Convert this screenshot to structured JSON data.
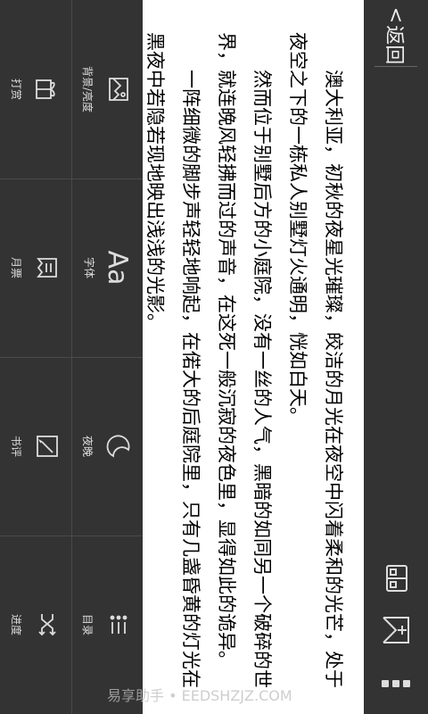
{
  "nav": {
    "back_label": "返回"
  },
  "toolbar_icons": [
    "bookshelf-icon",
    "add-bookmark-icon",
    "more-icon"
  ],
  "content": {
    "paragraphs": [
      "澳大利亚，初秋的夜星光璀璨，皎洁的月光在夜空中闪着柔和的光芒，处于夜空之下的一栋私人别墅灯火通明，恍如白天。",
      "然而位于别墅后方的小庭院，没有一丝的人气，黑暗的如同另一个破碎的世界，就连晚风轻拂而过的声音，在这死一般沉寂的夜色里，显得如此的诡异。",
      "一阵细微的脚步声轻轻地响起，在偌大的后庭院里，只有几盏昏黄的灯光在黑夜中若隐若现地映出浅浅的光影。"
    ]
  },
  "menu": {
    "background_brightness": "背景/亮度",
    "font": "字体",
    "night": "夜晚",
    "toc": "目录",
    "tip": "打赏",
    "monthly_ticket": "月票",
    "review": "书评",
    "progress": "进度"
  },
  "watermark": "易享助手 • EEDSHZJZ.COM"
}
